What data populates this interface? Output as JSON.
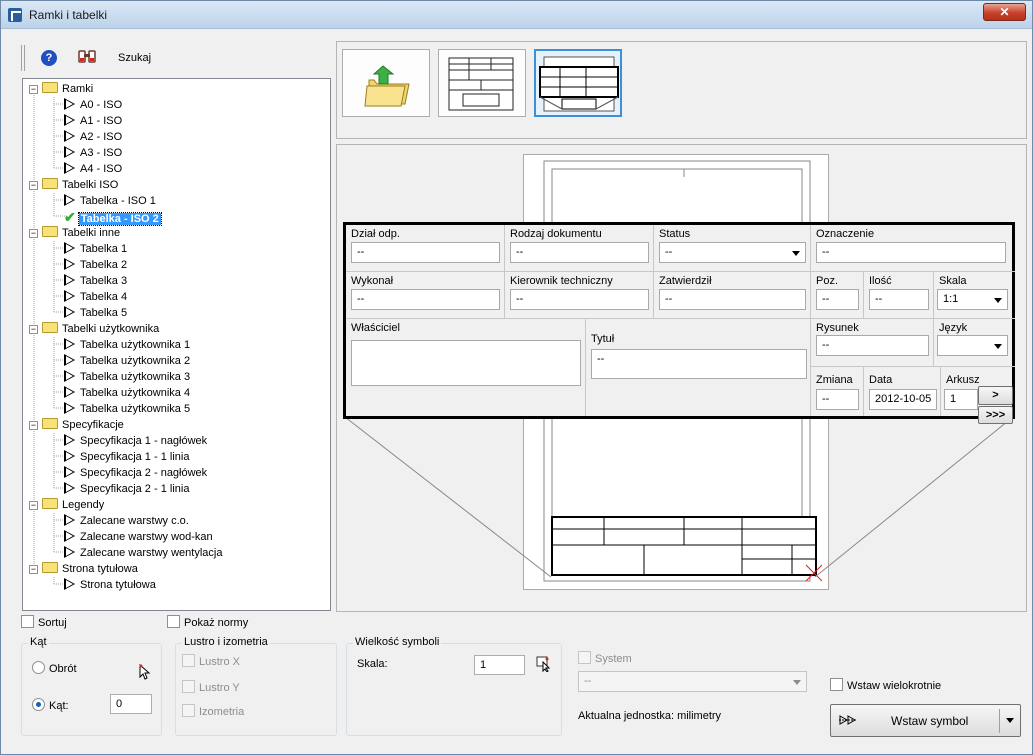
{
  "window": {
    "title": "Ramki i tabelki",
    "close_label": "✕"
  },
  "toolbar": {
    "search_label": "Szukaj",
    "help_label": "?"
  },
  "tree": {
    "groups": [
      {
        "label": "Ramki",
        "items": [
          "A0 - ISO",
          "A1 - ISO",
          "A2 - ISO",
          "A3 - ISO",
          "A4 - ISO"
        ]
      },
      {
        "label": "Tabelki ISO",
        "items": [
          "Tabelka - ISO 1",
          "Tabelka - ISO 2"
        ]
      },
      {
        "label": "Tabelki inne",
        "items": [
          "Tabelka 1",
          "Tabelka 2",
          "Tabelka 3",
          "Tabelka 4",
          "Tabelka 5"
        ]
      },
      {
        "label": "Tabelki użytkownika",
        "items": [
          "Tabelka użytkownika 1",
          "Tabelka użytkownika 2",
          "Tabelka użytkownika 3",
          "Tabelka użytkownika 4",
          "Tabelka użytkownika 5"
        ]
      },
      {
        "label": "Specyfikacje",
        "items": [
          "Specyfikacja 1 - nagłówek",
          "Specyfikacja 1 - 1 linia",
          "Specyfikacja 2 - nagłówek",
          "Specyfikacja 2 - 1 linia"
        ]
      },
      {
        "label": "Legendy",
        "items": [
          "Zalecane warstwy c.o.",
          "Zalecane warstwy wod-kan",
          "Zalecane warstwy wentylacja"
        ]
      },
      {
        "label": "Strona tytułowa",
        "items": [
          "Strona tytułowa"
        ]
      }
    ],
    "selected": "Tabelka - ISO 2"
  },
  "titleblock": {
    "dzial_label": "Dział odp.",
    "dzial_value": "--",
    "rodzaj_label": "Rodzaj dokumentu",
    "rodzaj_value": "--",
    "status_label": "Status",
    "status_value": "--",
    "oznaczenie_label": "Oznaczenie",
    "oznaczenie_value": "--",
    "wykonal_label": "Wykonał",
    "wykonal_value": "--",
    "kierownik_label": "Kierownik techniczny",
    "kierownik_value": "--",
    "zatwierdzil_label": "Zatwierdził",
    "zatwierdzil_value": "--",
    "poz_label": "Poz.",
    "poz_value": "--",
    "ilosc_label": "Ilość",
    "ilosc_value": "--",
    "skala_label": "Skala",
    "skala_value": "1:1",
    "wlasciciel_label": "Właściciel",
    "wlasciciel_value": "",
    "tytul_label": "Tytuł",
    "tytul_value": "--",
    "rysunek_label": "Rysunek",
    "rysunek_value": "--",
    "jezyk_label": "Język",
    "jezyk_value": "",
    "zmiana_label": "Zmiana",
    "zmiana_value": "--",
    "data_label": "Data",
    "data_value": "2012-10-05",
    "arkusz_label": "Arkusz",
    "arkusz_value": "1",
    "next_label": ">",
    "more_label": ">>>"
  },
  "options": {
    "sortuj_label": "Sortuj",
    "pokaz_normy_label": "Pokaż normy"
  },
  "kat_group": {
    "title": "Kąt",
    "obrot_label": "Obrót",
    "kat_label": "Kąt:",
    "kat_value": "0"
  },
  "lustro_group": {
    "title": "Lustro i izometria",
    "lustro_x": "Lustro X",
    "lustro_y": "Lustro Y",
    "izometria": "Izometria"
  },
  "wielkosc_group": {
    "title": "Wielkość symboli",
    "skala_label": "Skala:",
    "skala_value": "1"
  },
  "system": {
    "label": "System",
    "value": "--",
    "unit_text": "Aktualna jednostka: milimetry"
  },
  "insert": {
    "multi_label": "Wstaw wielokrotnie",
    "insert_label": "Wstaw symbol"
  }
}
